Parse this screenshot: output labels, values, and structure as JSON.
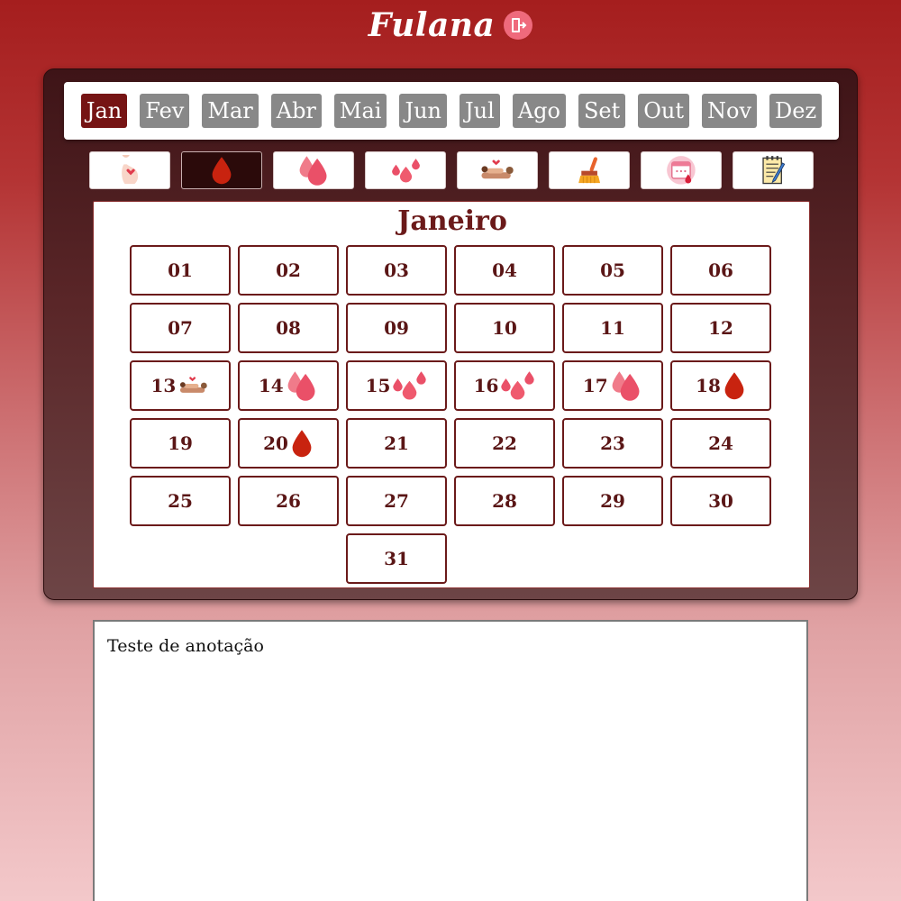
{
  "app": {
    "title": "Fulana"
  },
  "header": {
    "logout_icon": "logout-icon"
  },
  "months": [
    {
      "label": "Jan",
      "active": true
    },
    {
      "label": "Fev",
      "active": false
    },
    {
      "label": "Mar",
      "active": false
    },
    {
      "label": "Abr",
      "active": false
    },
    {
      "label": "Mai",
      "active": false
    },
    {
      "label": "Jun",
      "active": false
    },
    {
      "label": "Jul",
      "active": false
    },
    {
      "label": "Ago",
      "active": false
    },
    {
      "label": "Set",
      "active": false
    },
    {
      "label": "Out",
      "active": false
    },
    {
      "label": "Nov",
      "active": false
    },
    {
      "label": "Dez",
      "active": false
    }
  ],
  "tools": [
    {
      "icon": "pregnancy-icon",
      "active": false
    },
    {
      "icon": "drop-dark-icon",
      "active": true
    },
    {
      "icon": "two-drops-icon",
      "active": false
    },
    {
      "icon": "three-drops-icon",
      "active": false
    },
    {
      "icon": "intercourse-icon",
      "active": false
    },
    {
      "icon": "broom-icon",
      "active": false
    },
    {
      "icon": "calendar-drop-icon",
      "active": false
    },
    {
      "icon": "notepad-icon",
      "active": false
    }
  ],
  "calendar": {
    "title": "Janeiro",
    "days": [
      {
        "label": "01"
      },
      {
        "label": "02"
      },
      {
        "label": "03"
      },
      {
        "label": "04"
      },
      {
        "label": "05"
      },
      {
        "label": "06"
      },
      {
        "label": "07"
      },
      {
        "label": "08"
      },
      {
        "label": "09"
      },
      {
        "label": "10"
      },
      {
        "label": "11"
      },
      {
        "label": "12"
      },
      {
        "label": "13",
        "icon": "intercourse-icon"
      },
      {
        "label": "14",
        "icon": "two-drops-icon"
      },
      {
        "label": "15",
        "icon": "three-drops-icon"
      },
      {
        "label": "16",
        "icon": "three-drops-icon"
      },
      {
        "label": "17",
        "icon": "two-drops-icon"
      },
      {
        "label": "18",
        "icon": "drop-dark-icon"
      },
      {
        "label": "19"
      },
      {
        "label": "20",
        "icon": "drop-dark-icon"
      },
      {
        "label": "21"
      },
      {
        "label": "22"
      },
      {
        "label": "23"
      },
      {
        "label": "24"
      },
      {
        "label": "25"
      },
      {
        "label": "26"
      },
      {
        "label": "27"
      },
      {
        "label": "28"
      },
      {
        "label": "29"
      },
      {
        "label": "30"
      },
      {
        "label": "31"
      }
    ]
  },
  "notes": {
    "value": "Teste de anotação"
  },
  "colors": {
    "accent": "#761414",
    "inactive_month": "#888888",
    "drop_dark": "#c8230f",
    "drop_pink": "#ef5a6e"
  }
}
